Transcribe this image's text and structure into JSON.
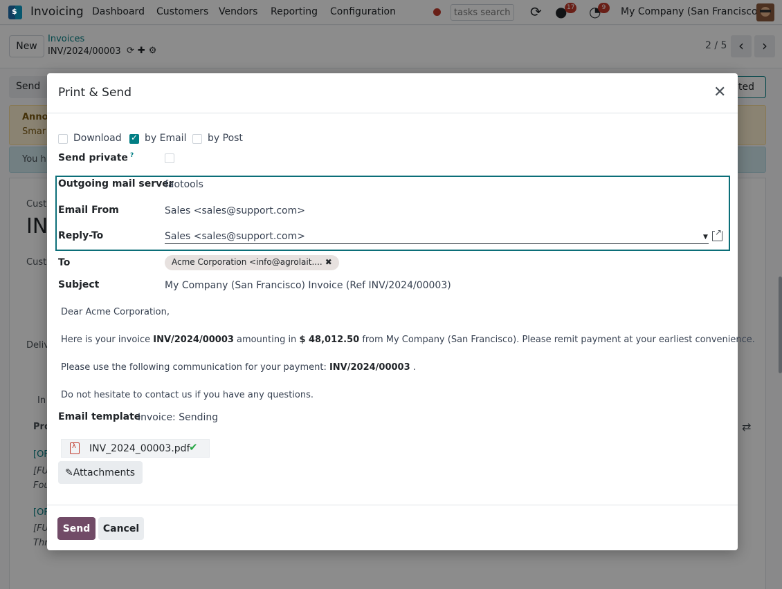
{
  "navbar": {
    "app_name": "Invoicing",
    "menu": [
      "Dashboard",
      "Customers",
      "Vendors",
      "Reporting",
      "Configuration"
    ],
    "search_placeholder": "tasks search",
    "messages_badge": "17",
    "activities_badge": "9",
    "company": "My Company (San Francisco)"
  },
  "control": {
    "new_label": "New",
    "breadcrumb_parent": "Invoices",
    "breadcrumb_current": "INV/2024/00003",
    "pager": "2 / 5"
  },
  "background": {
    "send_label": "Send",
    "right_button_partial": "ted",
    "warn_line1": "Anno",
    "warn_line2": "Smar",
    "info_text": "You h",
    "cust_label": "Cust",
    "big_title_partial": "IN",
    "cust_field": "Cust",
    "deliv_field": "Deliv",
    "tab_partial": "In",
    "products_partial": "Pro",
    "row1_a": "[OF",
    "row1_b": "[FU",
    "row1_c": "Fou",
    "row2_a": "[OF",
    "row2_b": "[FU",
    "row2_c": "Thr"
  },
  "modal": {
    "title": "Print & Send",
    "options": {
      "download": "Download",
      "by_email": "by Email",
      "by_post": "by Post"
    },
    "send_private_label": "Send private",
    "help_mark": "?",
    "outgoing_mail_server_label": "Outgoing mail server",
    "outgoing_mail_server_value": "faotools",
    "email_from_label": "Email From",
    "email_from_value": "Sales <sales@support.com>",
    "reply_to_label": "Reply-To",
    "reply_to_value": "Sales <sales@support.com>",
    "to_label": "To",
    "to_tag": "Acme Corporation <info@agrolait....",
    "subject_label": "Subject",
    "subject_value": "My Company (San Francisco) Invoice (Ref INV/2024/00003)",
    "body": {
      "greeting": "Dear Acme Corporation,",
      "p1_a": "Here is your invoice ",
      "p1_invoice": "INV/2024/00003",
      "p1_b": " amounting in ",
      "p1_amount": "$ 48,012.50",
      "p1_c": " from My Company (San Francisco). Please remit payment at your earliest convenience.",
      "p2_a": "Please use the following communication for your payment: ",
      "p2_ref": "INV/2024/00003",
      "p2_b": " .",
      "p3": "Do not hesitate to contact us if you have any questions."
    },
    "email_template_label": "Email template",
    "email_template_value": "Invoice: Sending",
    "attachment_name": "INV_2024_00003.pdf",
    "attachments_button": "Attachments",
    "send_button": "Send",
    "cancel_button": "Cancel"
  },
  "colors": {
    "primary": "#714b67",
    "accent": "#017e84",
    "highlight_border": "#0b6e78"
  }
}
